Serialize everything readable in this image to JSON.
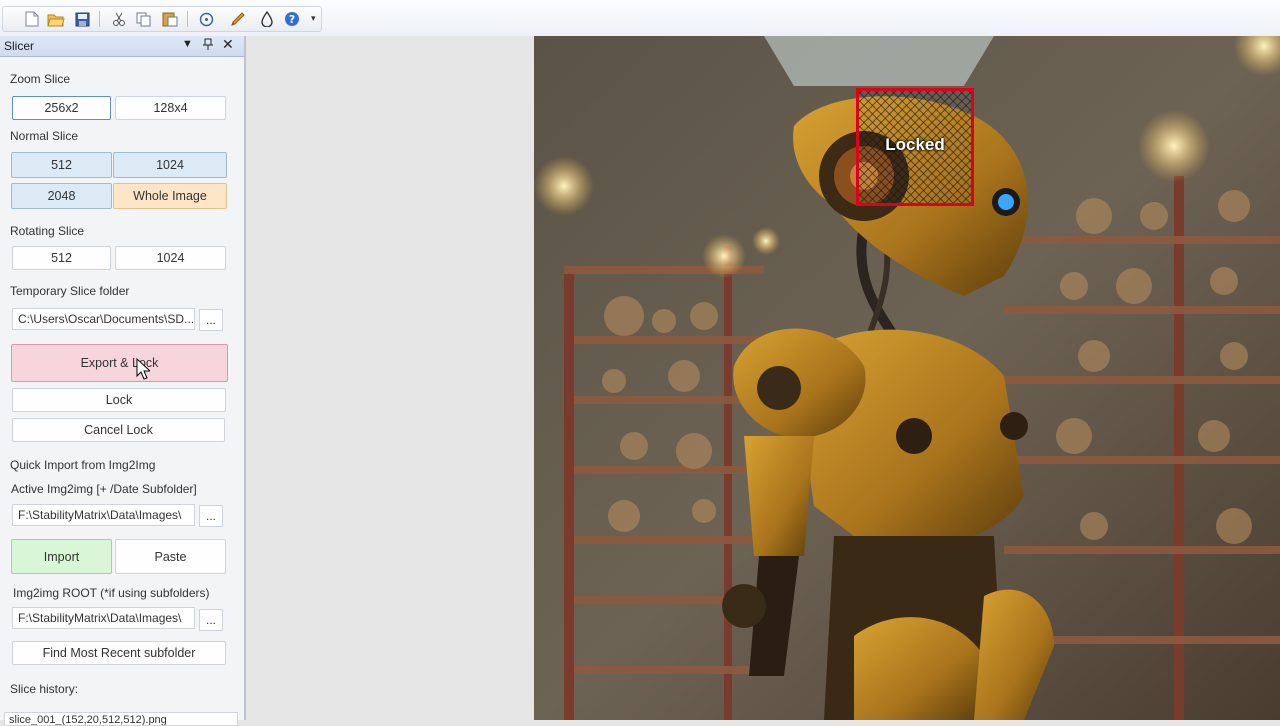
{
  "toolbar": {
    "icons": [
      "new-document-icon",
      "open-folder-icon",
      "save-icon",
      "cut-icon",
      "copy-icon",
      "paste-icon",
      "target-icon",
      "brush-icon",
      "drop-icon",
      "help-icon"
    ]
  },
  "panel": {
    "title": "Slicer",
    "zoom_slice": {
      "label": "Zoom Slice",
      "options": [
        "256x2",
        "128x4"
      ]
    },
    "normal_slice": {
      "label": "Normal Slice",
      "options": [
        "512",
        "1024",
        "2048",
        "Whole Image"
      ]
    },
    "rotating_slice": {
      "label": "Rotating Slice",
      "options": [
        "512",
        "1024"
      ]
    },
    "temp_folder": {
      "label": "Temporary Slice folder",
      "value": "C:\\Users\\Oscar\\Documents\\SD...",
      "browse": "..."
    },
    "export_lock": "Export & Lock",
    "lock": "Lock",
    "cancel_lock": "Cancel Lock",
    "quick_import": "Quick Import from Img2Img",
    "active_img2img": {
      "label": "Active Img2img [+ /Date Subfolder]",
      "value": "F:\\StabilityMatrix\\Data\\Images\\",
      "browse": "..."
    },
    "import": "Import",
    "paste": "Paste",
    "img2img_root": {
      "label": "Img2img ROOT (*if using subfolders)",
      "value": "F:\\StabilityMatrix\\Data\\Images\\",
      "browse": "..."
    },
    "find_recent": "Find Most Recent subfolder",
    "slice_history": {
      "label": "Slice history:",
      "first_item": "slice_001_(152,20,512,512).png"
    }
  },
  "canvas": {
    "lock_label": "Locked"
  },
  "colors": {
    "lock_border": "#e0001a",
    "export_bg": "#f6d6dc",
    "import_bg": "#d9f6d6",
    "whole_image_bg": "#fde6c8",
    "normal_bg": "#dceaf6"
  }
}
